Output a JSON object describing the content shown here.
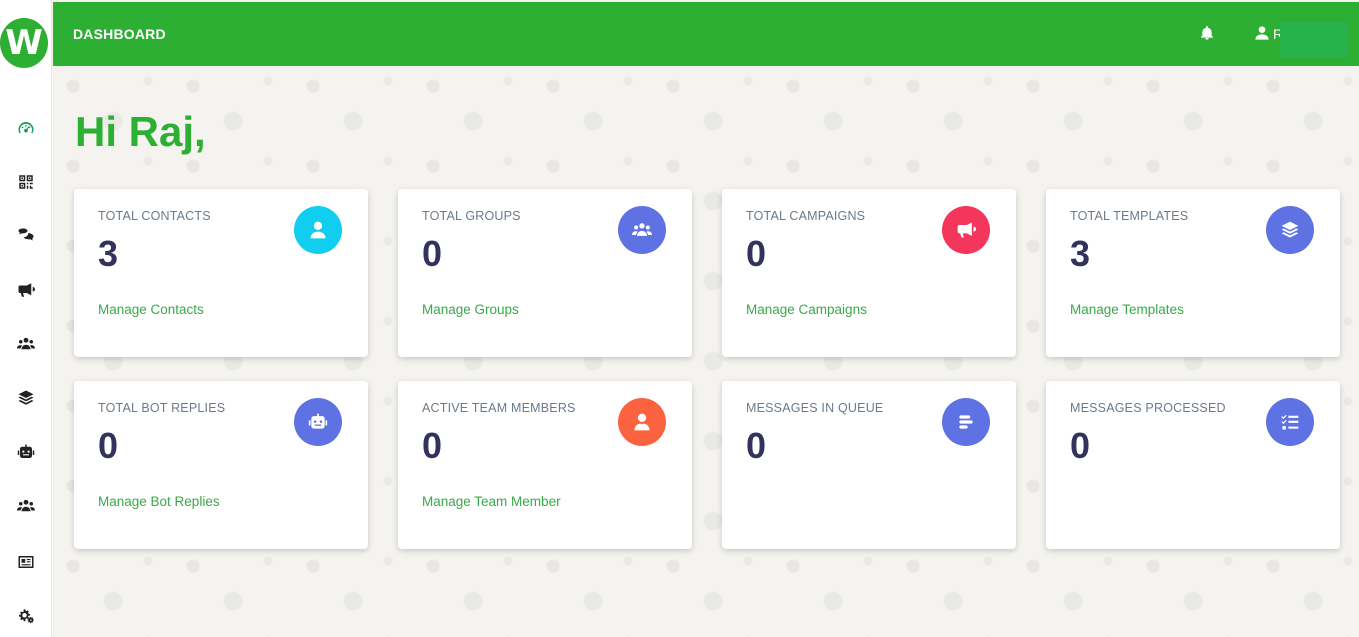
{
  "topbar": {
    "title": "DASHBOARD",
    "user_initial": "R"
  },
  "greeting": "Hi Raj,",
  "colors": {
    "brand": "#2daf33",
    "cyan": "#11cdef",
    "indigo": "#5e72e4",
    "red": "#f5365c",
    "orange": "#fb6340"
  },
  "sidebar": {
    "items": [
      {
        "name": "dashboard-icon"
      },
      {
        "name": "qrcode-icon"
      },
      {
        "name": "chat-icon"
      },
      {
        "name": "megaphone-icon"
      },
      {
        "name": "users-icon"
      },
      {
        "name": "layers-icon"
      },
      {
        "name": "robot-icon"
      },
      {
        "name": "team-icon"
      },
      {
        "name": "id-card-icon"
      },
      {
        "name": "settings-icon"
      }
    ]
  },
  "cards": [
    {
      "label": "TOTAL CONTACTS",
      "value": "3",
      "link": "Manage Contacts",
      "icon": "user-icon",
      "color": "#11cdef"
    },
    {
      "label": "TOTAL GROUPS",
      "value": "0",
      "link": "Manage Groups",
      "icon": "users-icon",
      "color": "#5e72e4"
    },
    {
      "label": "TOTAL CAMPAIGNS",
      "value": "0",
      "link": "Manage Campaigns",
      "icon": "megaphone-icon",
      "color": "#f5365c"
    },
    {
      "label": "TOTAL TEMPLATES",
      "value": "3",
      "link": "Manage Templates",
      "icon": "layers-icon",
      "color": "#5e72e4"
    },
    {
      "label": "TOTAL BOT REPLIES",
      "value": "0",
      "link": "Manage Bot Replies",
      "icon": "robot-icon",
      "color": "#5e72e4"
    },
    {
      "label": "ACTIVE TEAM MEMBERS",
      "value": "0",
      "link": "Manage Team Member",
      "icon": "user-tie-icon",
      "color": "#fb6340"
    },
    {
      "label": "MESSAGES IN QUEUE",
      "value": "0",
      "link": "",
      "icon": "queue-icon",
      "color": "#5e72e4"
    },
    {
      "label": "MESSAGES PROCESSED",
      "value": "0",
      "link": "",
      "icon": "tasks-icon",
      "color": "#5e72e4"
    }
  ]
}
